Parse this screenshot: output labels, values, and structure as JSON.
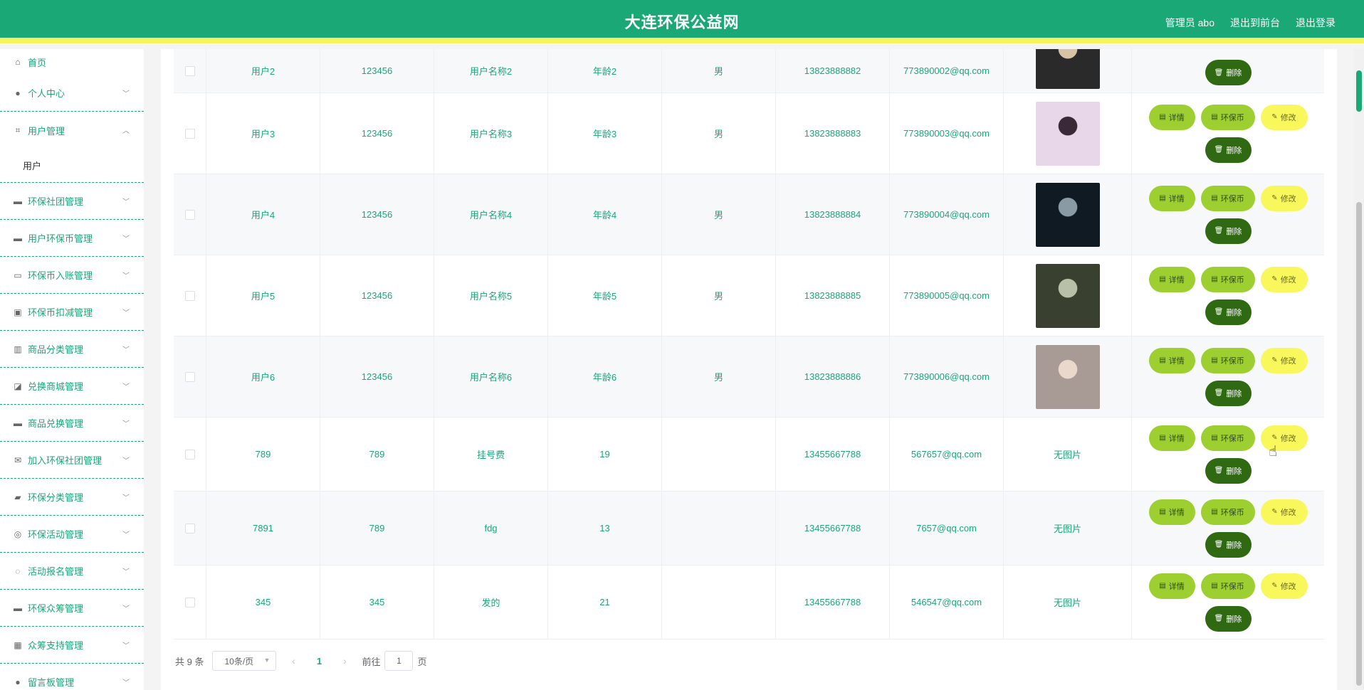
{
  "header": {
    "title": "大连环保公益网",
    "admin_label": "管理员 abo",
    "front_link": "退出到前台",
    "logout_link": "退出登录"
  },
  "sidebar": {
    "home": "首页",
    "items": [
      {
        "label": "个人中心",
        "icon": "person-icon"
      },
      {
        "label": "用户管理",
        "icon": "crop-icon",
        "expanded": true
      },
      {
        "label": "环保社团管理",
        "icon": "brush-icon"
      },
      {
        "label": "用户环保币管理",
        "icon": "monitor-icon"
      },
      {
        "label": "环保币入账管理",
        "icon": "card-icon"
      },
      {
        "label": "环保币扣减管理",
        "icon": "clipboard-icon"
      },
      {
        "label": "商品分类管理",
        "icon": "books-icon"
      },
      {
        "label": "兑换商城管理",
        "icon": "chart-icon"
      },
      {
        "label": "商品兑换管理",
        "icon": "chat-icon"
      },
      {
        "label": "加入环保社团管理",
        "icon": "mail-icon"
      },
      {
        "label": "环保分类管理",
        "icon": "hand-icon"
      },
      {
        "label": "环保活动管理",
        "icon": "compass-icon"
      },
      {
        "label": "活动报名管理",
        "icon": "power-icon"
      },
      {
        "label": "环保众筹管理",
        "icon": "desktop-icon"
      },
      {
        "label": "众筹支持管理",
        "icon": "grid-icon"
      },
      {
        "label": "留言板管理",
        "icon": "dot-icon"
      }
    ],
    "sub_item": "用户"
  },
  "table": {
    "rows": [
      {
        "user": "用户2",
        "password": "123456",
        "name": "用户名称2",
        "age": "年龄2",
        "sex": "男",
        "phone": "13823888882",
        "email": "773890002@qq.com",
        "photo": "portrait-dark",
        "photo_text": ""
      },
      {
        "user": "用户3",
        "password": "123456",
        "name": "用户名称3",
        "age": "年龄3",
        "sex": "男",
        "phone": "13823888883",
        "email": "773890003@qq.com",
        "photo": "portrait-cap",
        "photo_text": ""
      },
      {
        "user": "用户4",
        "password": "123456",
        "name": "用户名称4",
        "age": "年龄4",
        "sex": "男",
        "phone": "13823888884",
        "email": "773890004@qq.com",
        "photo": "portrait-night",
        "photo_text": ""
      },
      {
        "user": "用户5",
        "password": "123456",
        "name": "用户名称5",
        "age": "年龄5",
        "sex": "男",
        "phone": "13823888885",
        "email": "773890005@qq.com",
        "photo": "portrait-cafe",
        "photo_text": ""
      },
      {
        "user": "用户6",
        "password": "123456",
        "name": "用户名称6",
        "age": "年龄6",
        "sex": "男",
        "phone": "13823888886",
        "email": "773890006@qq.com",
        "photo": "portrait-girl",
        "photo_text": ""
      },
      {
        "user": "789",
        "password": "789",
        "name": "挂号费",
        "age": "19",
        "sex": "",
        "phone": "13455667788",
        "email": "567657@qq.com",
        "photo": "",
        "photo_text": "无图片"
      },
      {
        "user": "7891",
        "password": "789",
        "name": "fdg",
        "age": "13",
        "sex": "",
        "phone": "13455667788",
        "email": "7657@qq.com",
        "photo": "",
        "photo_text": "无图片"
      },
      {
        "user": "345",
        "password": "345",
        "name": "发的",
        "age": "21",
        "sex": "",
        "phone": "13455667788",
        "email": "546547@qq.com",
        "photo": "",
        "photo_text": "无图片"
      }
    ],
    "ops": {
      "detail": "详情",
      "coin": "环保币",
      "edit": "修改",
      "delete": "删除"
    }
  },
  "pager": {
    "total": "共 9 条",
    "size": "10条/页",
    "current": "1",
    "jump_prefix": "前往",
    "jump_value": "1",
    "jump_suffix": "页"
  },
  "colors": {
    "primary": "#1aa876",
    "accent_yellow": "#f5f35e",
    "btn_green": "#9ccf2f",
    "btn_dark": "#2f6a12"
  }
}
